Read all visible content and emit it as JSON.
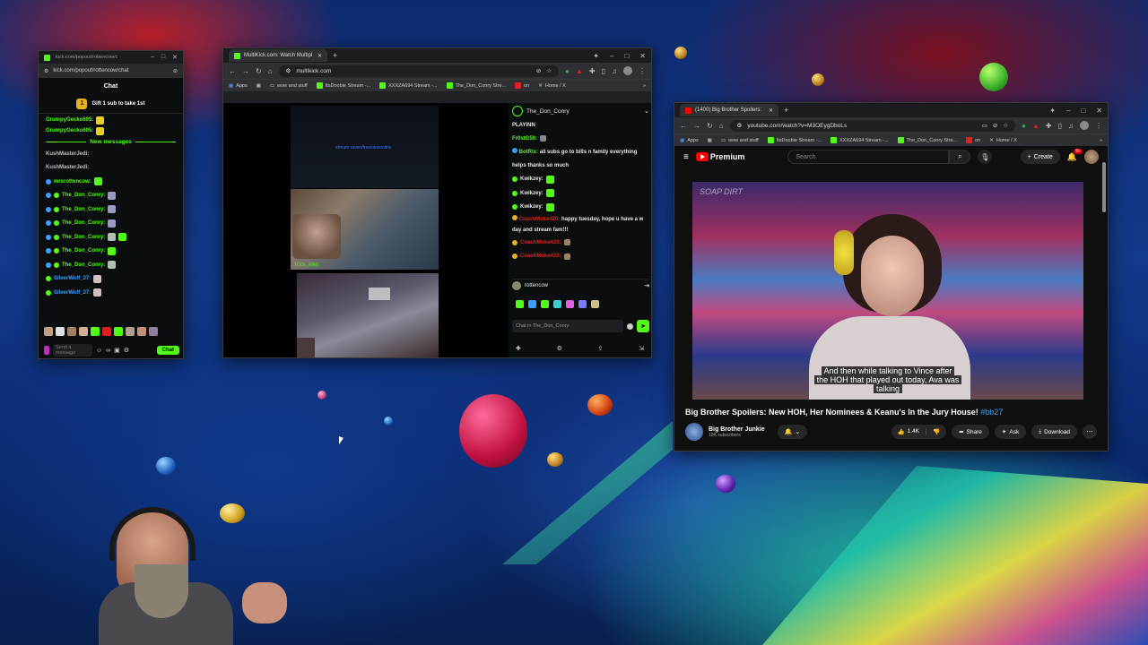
{
  "kick_popout": {
    "tab_title": "kick.com/popout/rottencow/c",
    "url": "kick.com/popout/rottencow/chat",
    "header": "Chat",
    "gift_banner": "Gift 1 sub to take 1st",
    "gift_count": "1",
    "new_messages": "New messages",
    "messages": [
      {
        "user": "GrumpyGecko605:",
        "color": "#53fc18"
      },
      {
        "user": "GrumpyGecko605:",
        "color": "#53fc18"
      },
      {
        "user": "KushMasterJedi:",
        "color": "#bdbdbd"
      },
      {
        "user": "KushMasterJedi:",
        "color": "#bdbdbd"
      },
      {
        "user": "mrsrottencow:",
        "color": "#53fc18"
      },
      {
        "user": "The_Don_Conry:",
        "color": "#53fc18"
      },
      {
        "user": "The_Don_Conry:",
        "color": "#53fc18"
      },
      {
        "user": "The_Don_Conry:",
        "color": "#53fc18"
      },
      {
        "user": "The_Don_Conry:",
        "color": "#53fc18"
      },
      {
        "user": "The_Don_Conry:",
        "color": "#53fc18"
      },
      {
        "user": "The_Don_Conry:",
        "color": "#53fc18"
      },
      {
        "user": "SilverWolf_27:",
        "color": "#3aa0ff"
      },
      {
        "user": "SilverWolf_27:",
        "color": "#3aa0ff"
      }
    ],
    "send_placeholder": "Send a message",
    "chat_button": "Chat"
  },
  "multikick": {
    "tab_title": "MultiKick.com: Watch Multipl",
    "url": "multikick.com",
    "bookmarks": [
      "Apps",
      "wow and stuff",
      "ItsDoobie Stream -...",
      "XXXZA694 Stream -...",
      "The_Don_Conry Stre...",
      "on",
      "Home / X"
    ],
    "streamer": "The_Don_Conry",
    "status": "PLAYINN",
    "chat": [
      {
        "user": "Fr0stG59:",
        "color": "#53fc18",
        "text": ""
      },
      {
        "user": "BotRix:",
        "color": "#53fc18",
        "text": "all subs go to bills n family everything helps thanks so much"
      },
      {
        "user": "Kwikzey:",
        "color": "#e8e8e8",
        "text": ""
      },
      {
        "user": "Kwikzey:",
        "color": "#e8e8e8",
        "text": ""
      },
      {
        "user": "Kwikzey:",
        "color": "#e8e8e8",
        "text": ""
      },
      {
        "user": "CoachMoke420:",
        "color": "#e02020",
        "text": "happy tuesday, hope u have a w day and stream fam!!!"
      },
      {
        "user": "CoachMoke420:",
        "color": "#e02020",
        "text": ""
      },
      {
        "user": "CoachMoke420:",
        "color": "#e02020",
        "text": ""
      }
    ],
    "second_streamer": "rottencow",
    "chat_placeholder": "Chat in The_Don_Conry",
    "game_label": "TOOL_RNG",
    "top_label": "stream.raven/freeviewonline"
  },
  "youtube": {
    "tab_title": "(1400) Big Brother Spoilers:",
    "url": "youtube.com/watch?v=M3OEygDboLs",
    "bookmarks": [
      "Apps",
      "wow and stuff",
      "ItsDoobie Stream -...",
      "XXXZA694 Stream -...",
      "The_Don_Conry Stre...",
      "on",
      "Home / X"
    ],
    "logo": "Premium",
    "search_placeholder": "Search",
    "create": "Create",
    "notif_count": "9+",
    "video_overlay_tag": "SOAP DIRT",
    "caption_line1": "And then while talking to Vince after",
    "caption_line2": "the HOH that played out today, Ava was",
    "caption_line3": "talking",
    "title": "Big Brother Spoilers: New HOH, Her Nominees & Keanu's In the Jury House! ",
    "hashtag": "#bb27",
    "channel": "Big Brother Junkie",
    "subs": "19K subscribers",
    "likes": "1.4K",
    "share": "Share",
    "ask": "Ask",
    "download": "Download"
  },
  "colors": {
    "kick_green": "#53fc18",
    "youtube_red": "#ff0000",
    "chrome_bg": "#202124"
  }
}
